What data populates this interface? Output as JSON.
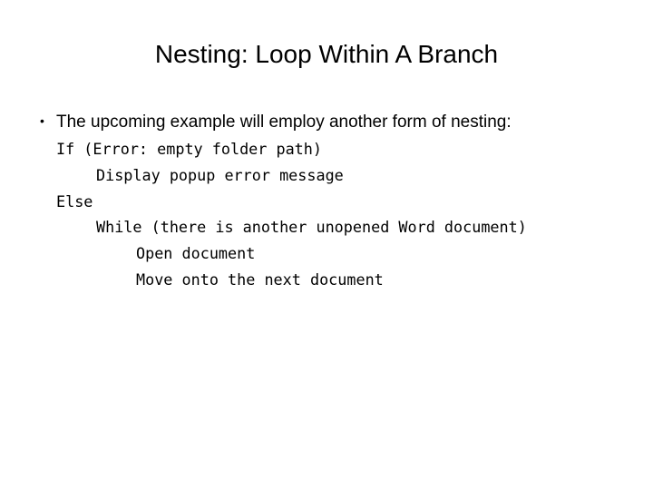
{
  "slide": {
    "title": "Nesting: Loop Within A Branch",
    "bullet": {
      "marker": "•",
      "text": "The upcoming example will employ another form of nesting:"
    },
    "code_lines": [
      {
        "level": 0,
        "text": "If (Error: empty folder path)"
      },
      {
        "level": 1,
        "text": "Display popup error message"
      },
      {
        "level": 0,
        "text": "Else"
      },
      {
        "level": 1,
        "text": "While (there is another unopened Word document)"
      },
      {
        "level": 2,
        "text": "Open document"
      },
      {
        "level": 2,
        "text": "Move onto the next document"
      }
    ]
  }
}
